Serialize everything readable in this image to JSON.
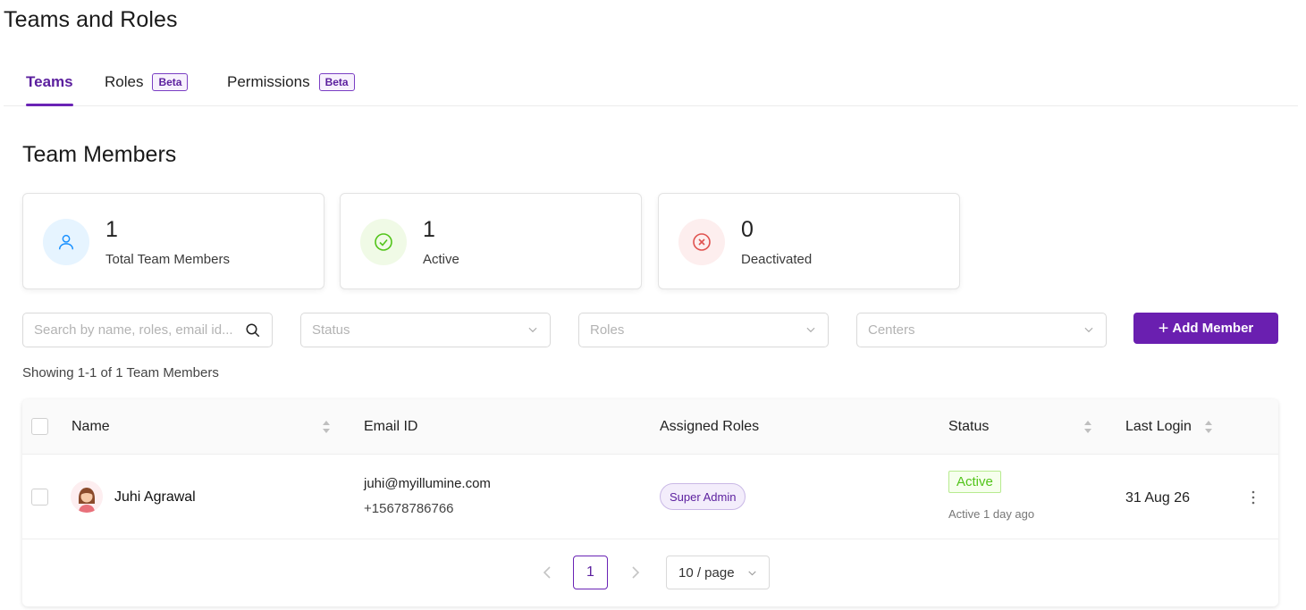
{
  "page": {
    "title": "Teams and Roles"
  },
  "tabs": [
    {
      "label": "Teams",
      "active": true
    },
    {
      "label": "Roles",
      "badge": "Beta"
    },
    {
      "label": "Permissions",
      "badge": "Beta"
    }
  ],
  "section": {
    "title": "Team Members"
  },
  "stats": {
    "total": {
      "value": "1",
      "label": "Total Team Members",
      "icon": "user-icon",
      "color": "#1890ff"
    },
    "active": {
      "value": "1",
      "label": "Active",
      "icon": "check-circle-icon",
      "color": "#52c41a"
    },
    "deactivated": {
      "value": "0",
      "label": "Deactivated",
      "icon": "close-circle-icon",
      "color": "#e0524f"
    }
  },
  "filters": {
    "search_placeholder": "Search by name, roles, email id...",
    "status_placeholder": "Status",
    "roles_placeholder": "Roles",
    "centers_placeholder": "Centers"
  },
  "add_member": {
    "label": "Add Member",
    "color": "#6a1fb0"
  },
  "showing_text": "Showing 1-1 of 1 Team Members",
  "table": {
    "columns": {
      "name": "Name",
      "email": "Email ID",
      "roles": "Assigned Roles",
      "status": "Status",
      "last_login": "Last Login"
    },
    "rows": [
      {
        "name": "Juhi Agrawal",
        "email": "juhi@myillumine.com",
        "phone": "+15678786766",
        "role": "Super Admin",
        "status": "Active",
        "status_sub": "Active 1 day ago",
        "last_login": "31 Aug 26"
      }
    ]
  },
  "pagination": {
    "current_page": "1",
    "page_size": "10 / page"
  }
}
